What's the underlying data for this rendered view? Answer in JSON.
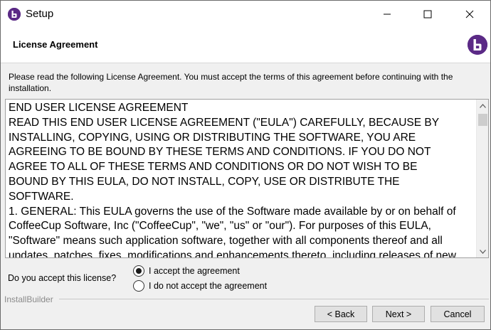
{
  "window": {
    "title": "Setup"
  },
  "header": {
    "title": "License Agreement"
  },
  "instruction": "Please read the following License Agreement. You must accept the terms of this agreement before continuing with the installation.",
  "license": {
    "lines": [
      "END USER LICENSE AGREEMENT",
      "READ THIS END USER LICENSE AGREEMENT (\"EULA\") CAREFULLY, BECAUSE BY",
      "INSTALLING, COPYING, USING OR DISTRIBUTING THE SOFTWARE, YOU ARE",
      "AGREEING TO BE BOUND BY THESE TERMS AND CONDITIONS. IF YOU DO NOT",
      "AGREE TO ALL OF THESE TERMS AND CONDITIONS OR DO NOT WISH TO BE",
      "BOUND BY THIS EULA, DO NOT INSTALL, COPY, USE OR DISTRIBUTE THE",
      "SOFTWARE.",
      "1. GENERAL: This EULA governs the use of the Software made available by or on behalf of",
      "CoffeeCup Software, Inc (\"CoffeeCup\", \"we\", \"us\" or \"our\"). For purposes of this EULA,",
      "\"Software\" means such application software, together with all components thereof and all",
      "updates, patches, fixes, modifications and enhancements thereto, including releases of new"
    ]
  },
  "accept": {
    "question": "Do you accept this license?",
    "options": [
      {
        "label": "I accept the agreement",
        "selected": true
      },
      {
        "label": "I do not accept the agreement",
        "selected": false
      }
    ]
  },
  "footer": {
    "brand": "InstallBuilder",
    "back_label": "< Back",
    "next_label": "Next >",
    "cancel_label": "Cancel"
  },
  "icons": {
    "app": "bitnami-logo-icon",
    "minimize": "minimize-icon",
    "maximize": "maximize-icon",
    "close": "close-icon",
    "scroll_up": "chevron-up-icon",
    "scroll_down": "chevron-down-icon"
  },
  "colors": {
    "brand": "#5b2a86"
  }
}
